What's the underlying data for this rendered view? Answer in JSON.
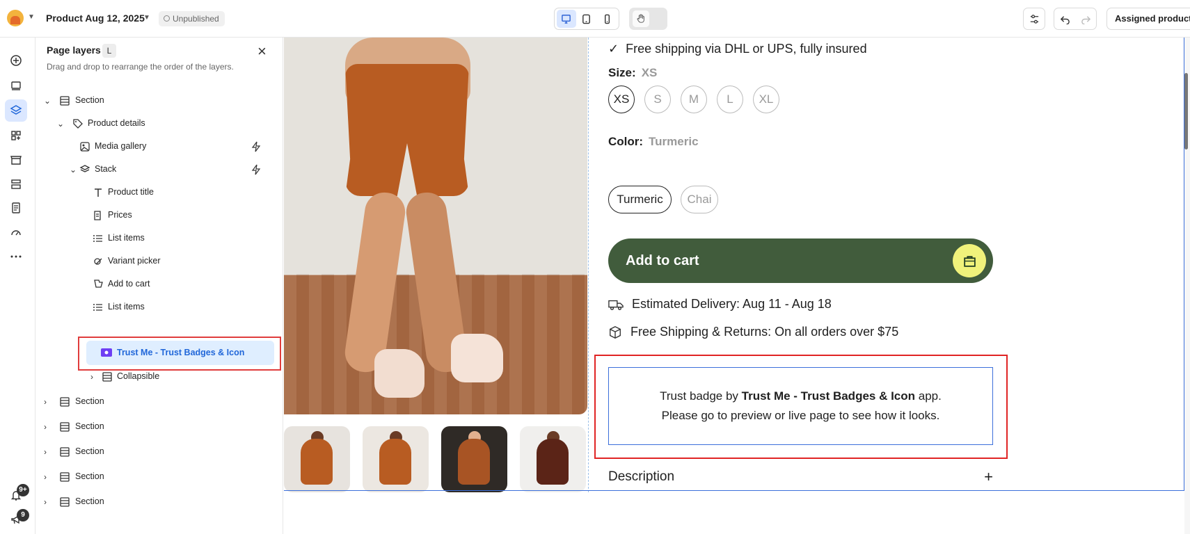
{
  "topbar": {
    "page_name": "Product Aug 12, 2025",
    "status": "Unpublished",
    "assigned_label": "Assigned products",
    "devices": [
      "desktop-icon",
      "tablet-icon",
      "mobile-icon"
    ]
  },
  "rail": {
    "notifications_badge": "9+",
    "announcements_badge": "9"
  },
  "layers": {
    "title": "Page layers",
    "shortcut": "L",
    "subtitle": "Drag and drop to rearrange the order of the layers.",
    "items": [
      {
        "label": "Section"
      },
      {
        "label": "Product details"
      },
      {
        "label": "Media gallery"
      },
      {
        "label": "Stack"
      },
      {
        "label": "Product title"
      },
      {
        "label": "Prices"
      },
      {
        "label": "List items"
      },
      {
        "label": "Variant picker"
      },
      {
        "label": "Add to cart"
      },
      {
        "label": "List items"
      },
      {
        "label": "Trust Me - Trust Badges & Icon"
      },
      {
        "label": "Collapsible"
      },
      {
        "label": "Section"
      },
      {
        "label": "Section"
      },
      {
        "label": "Section"
      },
      {
        "label": "Section"
      },
      {
        "label": "Section"
      }
    ]
  },
  "product": {
    "shipping_line": "Free shipping via DHL or UPS, fully insured",
    "size_label": "Size:",
    "size_value": "XS",
    "sizes": [
      "XS",
      "S",
      "M",
      "L",
      "XL"
    ],
    "color_label": "Color:",
    "color_value": "Turmeric",
    "colors": [
      "Turmeric",
      "Chai"
    ],
    "cart_label": "Add to cart",
    "delivery": "Estimated Delivery: Aug 11 - Aug 18",
    "returns": "Free Shipping & Returns: On all orders over $75",
    "trust_before": "Trust badge by",
    "trust_app": "Trust Me - Trust Badges & Icon",
    "trust_after": "app.",
    "trust_line2": "Please go to preview or live page to see how it looks.",
    "description_label": "Description",
    "description_toggle": "+"
  },
  "colors": {
    "selection_blue": "#2167d9",
    "selection_bg": "#dfeeff",
    "highlight_red": "#e02424",
    "cart_green": "#415c3c",
    "cart_icon_bg": "#f0f27b",
    "product_orange": "#b85c22"
  }
}
